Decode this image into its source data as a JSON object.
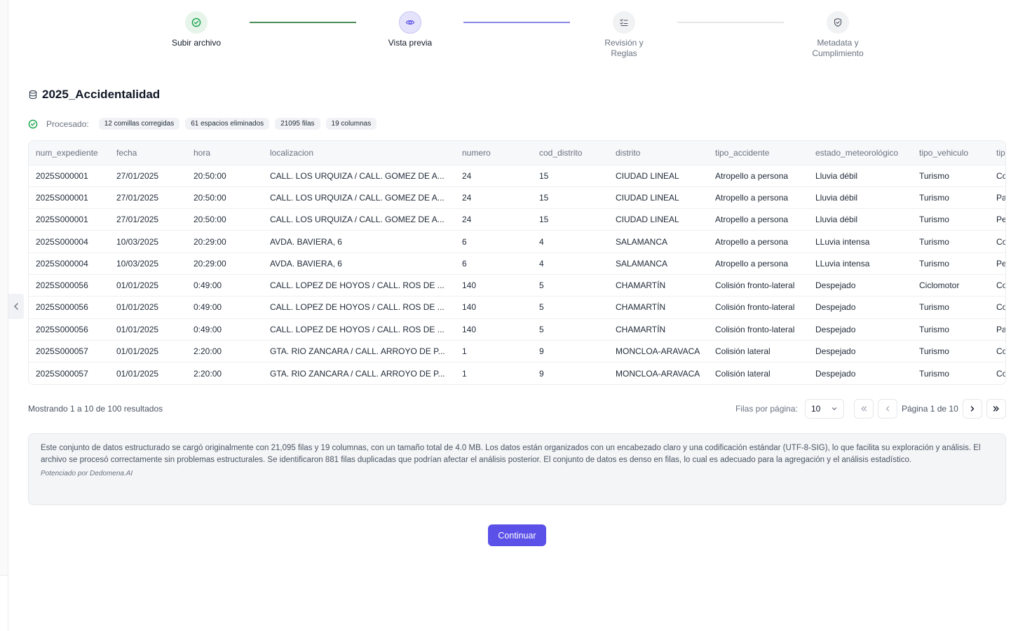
{
  "colors": {
    "accent": "#5b50e8",
    "done": "#16a34a",
    "done_line": "#4d8c57",
    "active_line": "#8c88e6",
    "todo_line": "#e5e7eb"
  },
  "stepper": {
    "steps": [
      {
        "label": "Subir archivo",
        "state": "done",
        "icon": "check-circle-icon"
      },
      {
        "label": "Vista previa",
        "state": "active",
        "icon": "eye-icon"
      },
      {
        "label": "Revisión y\nReglas",
        "state": "todo",
        "icon": "list-check-icon"
      },
      {
        "label": "Metadata y\nCumplimiento",
        "state": "todo",
        "icon": "shield-check-icon"
      }
    ]
  },
  "dataset": {
    "icon": "database-icon",
    "name": "2025_Accidentalidad"
  },
  "processed": {
    "label": "Procesado:",
    "chips": [
      "12 comillas corregidas",
      "61 espacios eliminados",
      "21095 filas",
      "19 columnas"
    ]
  },
  "table": {
    "columns": [
      "num_expediente",
      "fecha",
      "hora",
      "localizacion",
      "numero",
      "cod_distrito",
      "distrito",
      "tipo_accidente",
      "estado_meteorológico",
      "tipo_vehiculo",
      "tip"
    ],
    "rows": [
      [
        "2025S000001",
        "27/01/2025",
        "20:50:00",
        "CALL. LOS URQUIZA / CALL. GOMEZ DE A...",
        "24",
        "15",
        "CIUDAD LINEAL",
        "Atropello a persona",
        "Lluvia débil",
        "Turismo",
        "Co"
      ],
      [
        "2025S000001",
        "27/01/2025",
        "20:50:00",
        "CALL. LOS URQUIZA / CALL. GOMEZ DE A...",
        "24",
        "15",
        "CIUDAD LINEAL",
        "Atropello a persona",
        "Lluvia débil",
        "Turismo",
        "Pa"
      ],
      [
        "2025S000001",
        "27/01/2025",
        "20:50:00",
        "CALL. LOS URQUIZA / CALL. GOMEZ DE A...",
        "24",
        "15",
        "CIUDAD LINEAL",
        "Atropello a persona",
        "Lluvia débil",
        "Turismo",
        "Pe"
      ],
      [
        "2025S000004",
        "10/03/2025",
        "20:29:00",
        "AVDA. BAVIERA, 6",
        "6",
        "4",
        "SALAMANCA",
        "Atropello a persona",
        "LLuvia intensa",
        "Turismo",
        "Co"
      ],
      [
        "2025S000004",
        "10/03/2025",
        "20:29:00",
        "AVDA. BAVIERA, 6",
        "6",
        "4",
        "SALAMANCA",
        "Atropello a persona",
        "LLuvia intensa",
        "Turismo",
        "Pe"
      ],
      [
        "2025S000056",
        "01/01/2025",
        "0:49:00",
        "CALL. LOPEZ DE HOYOS / CALL. ROS DE ...",
        "140",
        "5",
        "CHAMARTÍN",
        "Colisión fronto-lateral",
        "Despejado",
        "Ciclomotor",
        "Co"
      ],
      [
        "2025S000056",
        "01/01/2025",
        "0:49:00",
        "CALL. LOPEZ DE HOYOS / CALL. ROS DE ...",
        "140",
        "5",
        "CHAMARTÍN",
        "Colisión fronto-lateral",
        "Despejado",
        "Turismo",
        "Co"
      ],
      [
        "2025S000056",
        "01/01/2025",
        "0:49:00",
        "CALL. LOPEZ DE HOYOS / CALL. ROS DE ...",
        "140",
        "5",
        "CHAMARTÍN",
        "Colisión fronto-lateral",
        "Despejado",
        "Turismo",
        "Pa"
      ],
      [
        "2025S000057",
        "01/01/2025",
        "2:20:00",
        "GTA. RIO ZANCARA / CALL. ARROYO DE P...",
        "1",
        "9",
        "MONCLOA-ARAVACA",
        "Colisión lateral",
        "Despejado",
        "Turismo",
        "Co"
      ],
      [
        "2025S000057",
        "01/01/2025",
        "2:20:00",
        "GTA. RIO ZANCARA / CALL. ARROYO DE P...",
        "1",
        "9",
        "MONCLOA-ARAVACA",
        "Colisión lateral",
        "Despejado",
        "Turismo",
        "Co"
      ]
    ]
  },
  "pagination": {
    "showing": "Mostrando 1 a 10 de 100 resultados",
    "rows_label": "Filas por página:",
    "rows_value": "10",
    "page_info": "Página 1 de 10"
  },
  "summary": {
    "text": "Este conjunto de datos estructurado se cargó originalmente con 21,095 filas y 19 columnas, con un tamaño total de 4.0 MB. Los datos están organizados con un encabezado claro y una codificación estándar (UTF-8-SIG), lo que facilita su exploración y análisis. El archivo se procesó correctamente sin problemas estructurales. Se identificaron 881 filas duplicadas que podrían afectar el análisis posterior. El conjunto de datos es denso en filas, lo cual es adecuado para la agregación y el análisis estadístico.",
    "powered_by": "Potenciado por Dedomena.AI"
  },
  "actions": {
    "continue_label": "Continuar"
  }
}
